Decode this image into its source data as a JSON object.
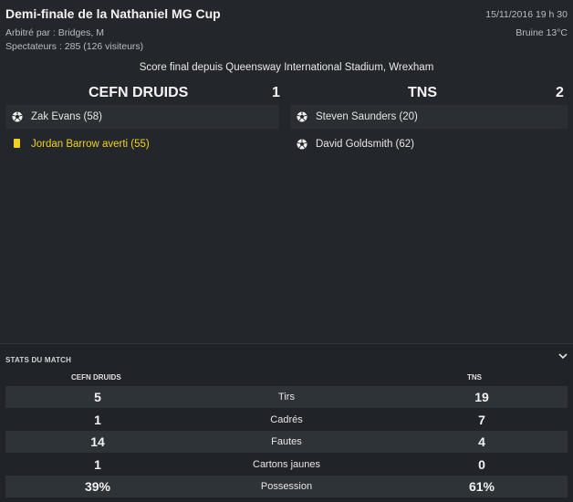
{
  "match": {
    "title": "Demi-finale de la Nathaniel MG Cup",
    "referee": "Arbitré par : Bridges, M",
    "attendance": "Spectateurs : 285 (126 visiteurs)",
    "datetime": "15/11/2016 19 h 30",
    "weather": "Bruine 13°C",
    "venue": "Score final depuis Queensway International Stadium, Wrexham"
  },
  "home": {
    "name": "CEFN DRUIDS",
    "score": "1",
    "events": [
      {
        "text": "Zak Evans (58)",
        "icon": "soccer-ball-icon"
      },
      {
        "text": "Jordan Barrow averti (55)",
        "icon": "yellow-card-icon"
      }
    ]
  },
  "away": {
    "name": "TNS",
    "score": "2",
    "events": [
      {
        "text": "Steven Saunders (20)",
        "icon": "soccer-ball-icon"
      },
      {
        "text": "David Goldsmith (62)",
        "icon": "soccer-ball-icon"
      }
    ]
  },
  "stats": {
    "section_title": "STATS DU MATCH",
    "home_header": "CEFN DRUIDS",
    "away_header": "TNS",
    "rows": [
      {
        "label": "Tirs",
        "home": "5",
        "away": "19"
      },
      {
        "label": "Cadrés",
        "home": "1",
        "away": "7"
      },
      {
        "label": "Fautes",
        "home": "14",
        "away": "4"
      },
      {
        "label": "Cartons jaunes",
        "home": "1",
        "away": "0"
      },
      {
        "label": "Possession",
        "home": "39%",
        "away": "61%"
      }
    ]
  },
  "colors": {
    "background": "#23272b",
    "yellow_card": "#f2d21b",
    "row_shade": "#2e3338"
  }
}
